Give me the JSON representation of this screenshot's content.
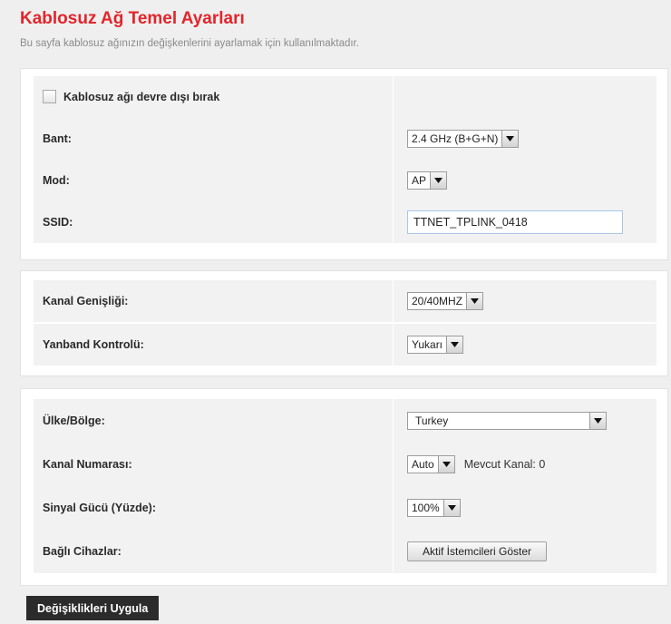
{
  "page": {
    "title": "Kablosuz Ağ Temel Ayarları",
    "subtitle": "Bu sayfa kablosuz ağınızın değişkenlerini ayarlamak için kullanılmaktadır."
  },
  "panel1": {
    "disable_label": "Kablosuz ağı devre dışı bırak",
    "disable_checked": false,
    "band_label": "Bant:",
    "band_value": "2.4 GHz (B+G+N)",
    "mode_label": "Mod:",
    "mode_value": "AP",
    "ssid_label": "SSID:",
    "ssid_value": "TTNET_TPLINK_0418"
  },
  "panel2": {
    "channel_width_label": "Kanal Genişliği:",
    "channel_width_value": "20/40MHZ",
    "sideband_label": "Yanband Kontrolü:",
    "sideband_value": "Yukarı"
  },
  "panel3": {
    "country_label": "Ülke/Bölge:",
    "country_value": "Turkey",
    "channel_label": "Kanal Numarası:",
    "channel_value": "Auto",
    "current_channel": "Mevcut Kanal: 0",
    "power_label": "Sinyal Gücü (Yüzde):",
    "power_value": "100%",
    "clients_label": "Bağlı Cihazlar:",
    "clients_button": "Aktif İstemcileri Göster"
  },
  "apply_button": "Değişiklikleri Uygula",
  "icons": {
    "dropdown": "chevron-down-icon",
    "checkbox": "checkbox-icon"
  }
}
